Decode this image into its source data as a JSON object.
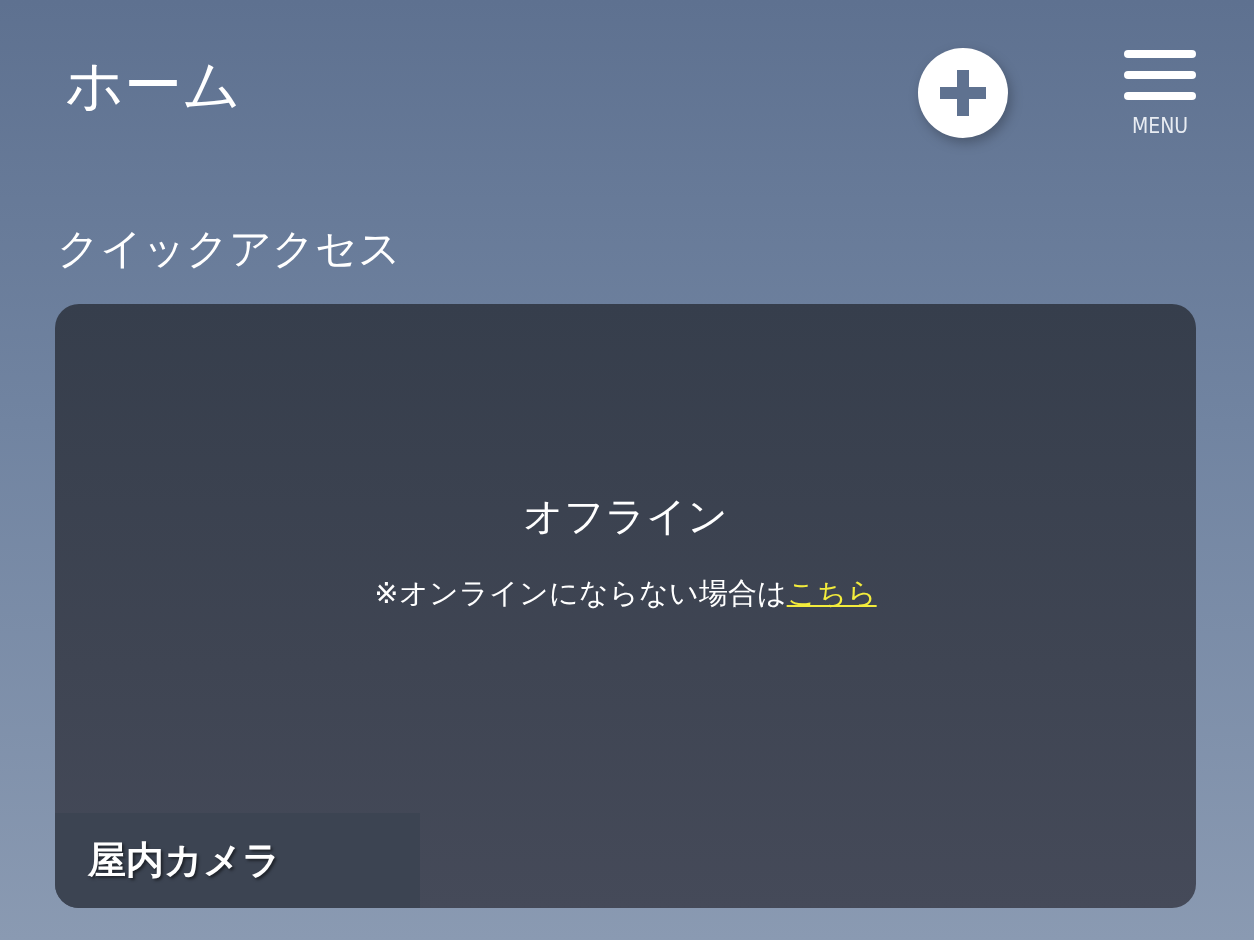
{
  "header": {
    "title": "ホーム",
    "menu_label": "MENU"
  },
  "section_title": "クイックアクセス",
  "camera_card": {
    "status": "オフライン",
    "note": "※オンラインにならない場合は",
    "link": "こちら",
    "name": "屋内カメラ"
  }
}
